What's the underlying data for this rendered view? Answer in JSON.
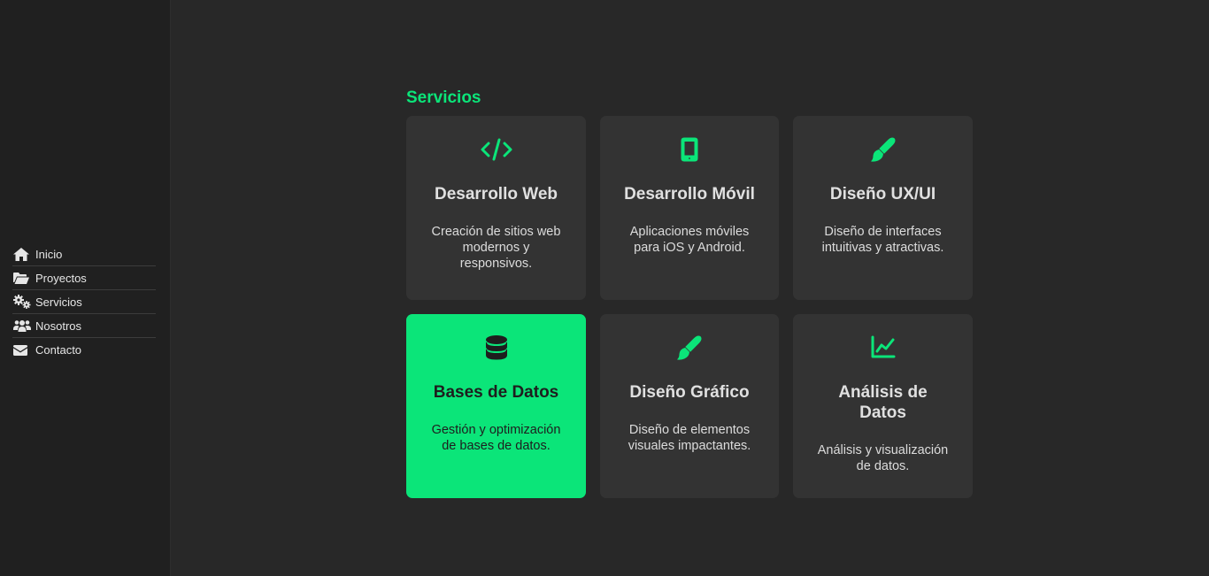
{
  "nav": [
    {
      "label": "Inicio",
      "icon": "home-icon"
    },
    {
      "label": "Proyectos",
      "icon": "folder-open-icon"
    },
    {
      "label": "Servicios",
      "icon": "cogs-icon"
    },
    {
      "label": "Nosotros",
      "icon": "users-icon"
    },
    {
      "label": "Contacto",
      "icon": "envelope-icon"
    }
  ],
  "services": {
    "title": "Servicios",
    "items": [
      {
        "title": "Desarrollo Web",
        "description": "Creación de sitios web modernos y responsivos.",
        "icon": "code-icon"
      },
      {
        "title": "Desarrollo Móvil",
        "description": "Aplicaciones móviles para iOS y Android.",
        "icon": "mobile-icon"
      },
      {
        "title": "Diseño UX/UI",
        "description": "Diseño de interfaces intuitivas y atractivas.",
        "icon": "paint-brush-icon"
      },
      {
        "title": "Bases de Datos",
        "description": "Gestión y optimización de bases de datos.",
        "icon": "database-icon"
      },
      {
        "title": "Diseño Gráfico",
        "description": "Diseño de elementos visuales impactantes.",
        "icon": "paint-brush-icon"
      },
      {
        "title": "Análisis de Datos",
        "description": "Análisis y visualización de datos.",
        "icon": "chart-line-icon"
      }
    ]
  },
  "colors": {
    "accent": "#0be579",
    "background": "#282828",
    "sidebar": "#202020",
    "card": "#333333"
  }
}
